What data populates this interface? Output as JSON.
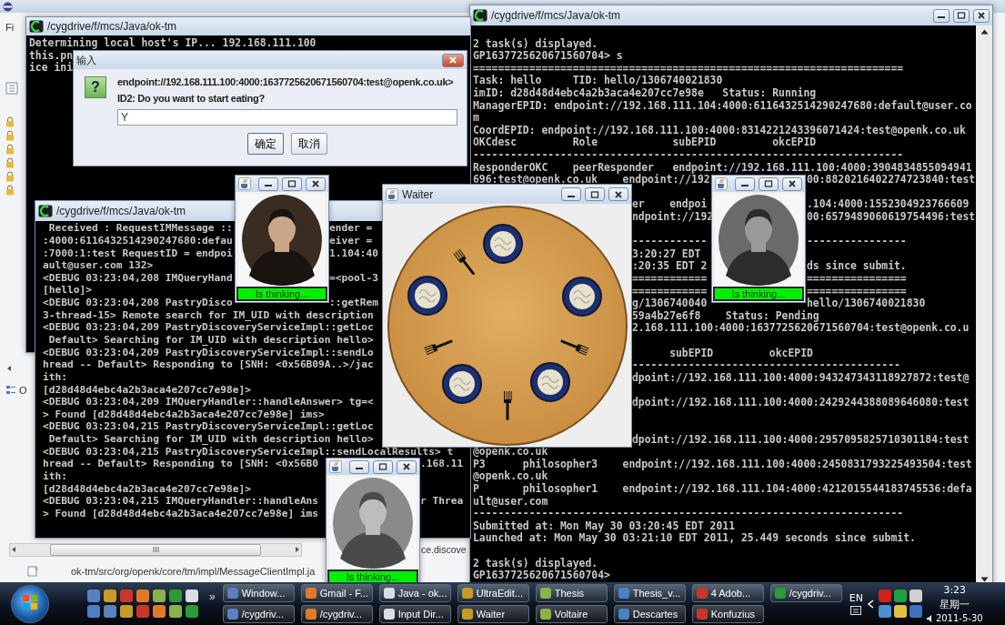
{
  "eclipse": {
    "menu_fragment": "Fi",
    "outline_fragment": "O",
    "editor_fragment": "ce.discove",
    "status_path": "ok-tm/src/org/openk/core/tm/impl/MessageClientImpl.ja"
  },
  "terminal_back": {
    "title": "/cygdrive/f/mcs/Java/ok-tm",
    "lines": [
      {
        "kind": "text",
        "segments": [
          "Determining local host's IP... 192.168.111.100"
        ]
      },
      {
        "kind": "text",
        "segments": [
          "this.pn"
        ]
      },
      {
        "kind": "text",
        "segments": [
          "ice ini"
        ]
      }
    ]
  },
  "dialog": {
    "title": "输入",
    "question_mark": "?",
    "message_lines": [
      "endpoint://192.168.111.100:4000:1637725620671560704:test@openk.co.uk>",
      "ID2: Do you want to start eating?"
    ],
    "input": {
      "value": "Y"
    },
    "buttons": [
      "确定",
      "取消"
    ]
  },
  "terminal_right": {
    "title": "/cygdrive/f/mcs/Java/ok-tm",
    "lines": [
      {
        "kind": "blank"
      },
      {
        "kind": "text",
        "segments": [
          "2 task(s) displayed."
        ]
      },
      {
        "kind": "text",
        "segments": [
          "GP1637725620671560704> s"
        ]
      },
      {
        "kind": "text",
        "segments": [
          "====================================================================="
        ]
      },
      {
        "kind": "text",
        "segments": [
          "Task: hello     TID: hello/1306740021830"
        ]
      },
      {
        "kind": "text",
        "segments": [
          "imID: d28d48d4ebc4a2b3aca4e207cc7e98e   Status: Running"
        ]
      },
      {
        "kind": "text",
        "segments": [
          "ManagerEPID: endpoint://192.168.111.104:4000:6116432514290247680:default@user.co"
        ]
      },
      {
        "kind": "text",
        "segments": [
          "m"
        ]
      },
      {
        "kind": "text",
        "segments": [
          "CoordEPID: endpoint://192.168.111.100:4000:8314221243396071424:test@openk.co.uk"
        ]
      },
      {
        "kind": "text",
        "segments": [
          "OKCdesc         Role            subEPID         okcEPID"
        ]
      },
      {
        "kind": "text",
        "segments": [
          "---------------------------------------------------------------------"
        ]
      },
      {
        "kind": "text",
        "segments": [
          "ResponderOKC    peerResponder   endpoint://192.168.111.100:4000:3904834855094941"
        ]
      },
      {
        "kind": "text",
        "segments": [
          "696:test@openk.co.uk    endpoint://192",
          "00:8820216402274723840:test"
        ]
      },
      {
        "kind": "blank"
      },
      {
        "kind": "text",
        "segments": [
          "er    endpoi",
          ".104:4000:1552304923766609"
        ]
      },
      {
        "kind": "text",
        "segments": [
          "ndpoint://192",
          "00:6579489060619754496:test"
        ]
      },
      {
        "kind": "blank"
      },
      {
        "kind": "text",
        "segments": [
          "------------",
          "----------------"
        ]
      },
      {
        "kind": "text",
        "segments": [
          "3:20:27 EDT"
        ]
      },
      {
        "kind": "text",
        "segments": [
          ":20:35 EDT 2",
          "ds since submit."
        ]
      },
      {
        "kind": "text",
        "segments": [
          "============",
          "================"
        ]
      },
      {
        "kind": "text",
        "segments": [
          "============",
          "================"
        ]
      },
      {
        "kind": "text",
        "segments": [
          "g/1306740040",
          "hello/1306740021830"
        ]
      },
      {
        "kind": "text",
        "segments": [
          "59a4b27e6f8    Status: Pending"
        ]
      },
      {
        "kind": "text",
        "segments": [
          "2.168.111.100:4000:1637725620671560704:test@openk.co.u"
        ]
      },
      {
        "kind": "blank"
      },
      {
        "kind": "text",
        "segments": [
          "      subEPID         okcEPID"
        ]
      },
      {
        "kind": "text",
        "segments": [
          "-------------------------------------------"
        ]
      },
      {
        "kind": "text",
        "segments": [
          "dpoint://192.168.111.100:4000:943247343118927872:test@"
        ]
      },
      {
        "kind": "blank"
      },
      {
        "kind": "text",
        "segments": [
          "dpoint://192.168.111.100:4000:2429244388089646080:test"
        ]
      },
      {
        "kind": "blank"
      },
      {
        "kind": "blank"
      },
      {
        "kind": "text",
        "segments": [
          "dpoint://192.168.111.100:4000:2957095825710301184:test"
        ]
      },
      {
        "kind": "text",
        "segments": [
          "@openk.co.uk"
        ]
      },
      {
        "kind": "text",
        "segments": [
          "P3      philosopher3    endpoint://192.168.111.100:4000:2450831793225493504:test"
        ]
      },
      {
        "kind": "text",
        "segments": [
          "@openk.co.uk"
        ]
      },
      {
        "kind": "text",
        "segments": [
          "P       philosopher1    endpoint://192.168.111.104:4000:4212015544183745536:defa"
        ]
      },
      {
        "kind": "text",
        "segments": [
          "ult@user.com"
        ]
      },
      {
        "kind": "text",
        "segments": [
          "---------------------------------------------------------------------"
        ]
      },
      {
        "kind": "text",
        "segments": [
          "Submitted at: Mon May 30 03:20:45 EDT 2011"
        ]
      },
      {
        "kind": "text",
        "segments": [
          "Launched at: Mon May 30 03:21:10 EDT 2011, 25.449 seconds since submit."
        ]
      },
      {
        "kind": "blank"
      },
      {
        "kind": "text",
        "segments": [
          "2 task(s) displayed."
        ]
      },
      {
        "kind": "text",
        "segments": [
          "GP1637725620671560704>"
        ]
      }
    ]
  },
  "terminal_left": {
    "title": "/cygdrive/f/mcs/Java/ok-tm",
    "lines": [
      {
        "kind": "text",
        "segments": [
          " Received : RequestIMMessage ::",
          "ender = "
        ]
      },
      {
        "kind": "text",
        "segments": [
          ":4000:6116432514290247680:defau",
          "eiver = "
        ]
      },
      {
        "kind": "text",
        "segments": [
          ":7000:1:test RequestID = endpoi",
          "1.104:40"
        ]
      },
      {
        "kind": "text",
        "segments": [
          "ault@user.com 132>"
        ]
      },
      {
        "kind": "text",
        "segments": [
          "<DEBUG 03:23:04,208 IMQueryHand",
          "=<pool-3"
        ]
      },
      {
        "kind": "text",
        "segments": [
          "[hello]>"
        ]
      },
      {
        "kind": "text",
        "segments": [
          "<DEBUG 03:23:04,208 PastryDisco",
          "::getRem"
        ]
      },
      {
        "kind": "text",
        "segments": [
          "3-thread-15> Remote search for IM_UID with description"
        ]
      },
      {
        "kind": "text",
        "segments": [
          "<DEBUG 03:23:04,209 PastryDiscoveryServiceImpl::getLoc"
        ]
      },
      {
        "kind": "text",
        "segments": [
          " Default> Searching for IM_UID with description hello>"
        ]
      },
      {
        "kind": "text",
        "segments": [
          "<DEBUG 03:23:04,209 PastryDiscoveryServiceImpl::sendLo"
        ]
      },
      {
        "kind": "text",
        "segments": [
          "hread -- Default> Responding to [SNH: <0x56B09A..>/jac"
        ]
      },
      {
        "kind": "text",
        "segments": [
          "ith:"
        ]
      },
      {
        "kind": "text",
        "segments": [
          "[d28d48d4ebc4a2b3aca4e207cc7e98e]>"
        ]
      },
      {
        "kind": "text",
        "segments": [
          "<DEBUG 03:23:04,209 IMQueryHandler::handleAnswer> tg=<"
        ]
      },
      {
        "kind": "text",
        "segments": [
          "> Found [d28d48d4ebc4a2b3aca4e207cc7e98e] ims>"
        ]
      },
      {
        "kind": "text",
        "segments": [
          "<DEBUG 03:23:04,215 PastryDiscoveryServiceImpl::getLoc"
        ]
      },
      {
        "kind": "text",
        "segments": [
          " Default> Searching for IM_UID with description hello>"
        ]
      },
      {
        "kind": "text",
        "segments": [
          "<DEBUG 03:23:04,215 PastryDiscoveryServiceImpl::sendLocalResults> t"
        ]
      },
      {
        "kind": "text",
        "segments": [
          "hread -- Default> Responding to [SNH: <0x56B0",
          ".168.11"
        ]
      },
      {
        "kind": "text",
        "segments": [
          "ith:"
        ]
      },
      {
        "kind": "text",
        "segments": [
          "[d28d48d4ebc4a2b3aca4e207cc7e98e]>"
        ]
      },
      {
        "kind": "text",
        "segments": [
          "<DEBUG 03:23:04,215 IMQueryHandler::handleAns",
          "r Threa"
        ]
      },
      {
        "kind": "text",
        "segments": [
          "> Found [d28d48d4ebc4a2b3aca4e207cc7e98e] ims"
        ]
      }
    ]
  },
  "waiter": {
    "title": "Waiter"
  },
  "philosophers": [
    {
      "status": "Is thinking..."
    },
    {
      "status": "Is thinking..."
    },
    {
      "status": "Is thinking..."
    }
  ],
  "taskbar": {
    "overflow_glyph": "»",
    "rows": [
      [
        "Window...",
        "Gmail - F...",
        "Java - ok...",
        "UltraEdit...",
        "Thesis",
        "Thesis_v...",
        "4 Adob...",
        "/cygdriv..."
      ],
      [
        "/cygdriv...",
        "/cygdriv...",
        "Input Dir...",
        "Waiter",
        "Voltaire",
        "Descartes",
        "Konfuzius"
      ]
    ],
    "tray": {
      "language": "EN",
      "time": "3:23",
      "weekday": "星期一",
      "date": "2011-5-30"
    }
  }
}
